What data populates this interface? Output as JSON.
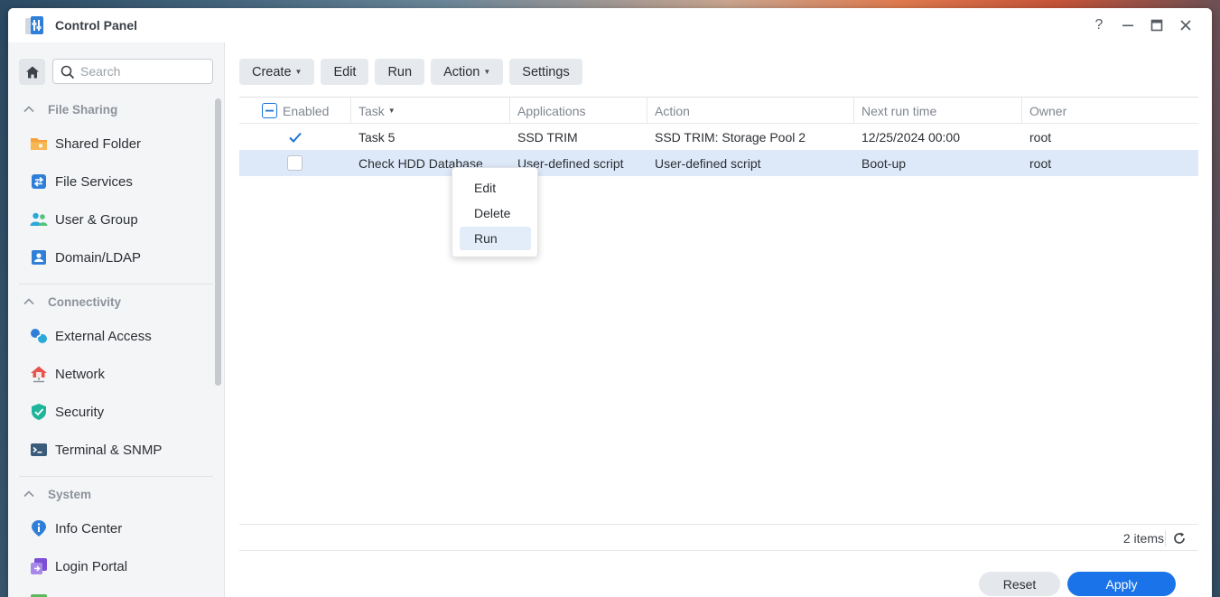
{
  "window": {
    "title": "Control Panel",
    "controls": {
      "help": "?",
      "minimize": "−",
      "maximize": "□",
      "close": "✕"
    }
  },
  "sidebar": {
    "search_placeholder": "Search",
    "sections": [
      {
        "label": "File Sharing",
        "items": [
          {
            "label": "Shared Folder",
            "icon": "shared-folder-icon"
          },
          {
            "label": "File Services",
            "icon": "file-services-icon"
          },
          {
            "label": "User & Group",
            "icon": "user-group-icon"
          },
          {
            "label": "Domain/LDAP",
            "icon": "domain-ldap-icon"
          }
        ]
      },
      {
        "label": "Connectivity",
        "items": [
          {
            "label": "External Access",
            "icon": "external-access-icon"
          },
          {
            "label": "Network",
            "icon": "network-icon"
          },
          {
            "label": "Security",
            "icon": "security-icon"
          },
          {
            "label": "Terminal & SNMP",
            "icon": "terminal-icon"
          }
        ]
      },
      {
        "label": "System",
        "items": [
          {
            "label": "Info Center",
            "icon": "info-center-icon"
          },
          {
            "label": "Login Portal",
            "icon": "login-portal-icon"
          }
        ]
      }
    ]
  },
  "toolbar": {
    "create": "Create",
    "edit": "Edit",
    "run": "Run",
    "action": "Action",
    "settings": "Settings"
  },
  "table": {
    "columns": [
      "Enabled",
      "Task",
      "Applications",
      "Action",
      "Next run time",
      "Owner"
    ],
    "rows": [
      {
        "enabled": true,
        "task": "Task 5",
        "applications": "SSD TRIM",
        "action": "SSD TRIM: Storage Pool 2",
        "next_run": "12/25/2024 00:00",
        "owner": "root",
        "selected": false
      },
      {
        "enabled": false,
        "task": "Check HDD Database",
        "applications": "User-defined script",
        "action": "User-defined script",
        "next_run": "Boot-up",
        "owner": "root",
        "selected": true
      }
    ]
  },
  "context_menu": {
    "items": [
      "Edit",
      "Delete",
      "Run"
    ],
    "highlighted": "Run"
  },
  "status": {
    "items_count": "2 items"
  },
  "footer": {
    "reset": "Reset",
    "apply": "Apply"
  },
  "colors": {
    "accent": "#1a73e8",
    "selected_row": "#dde9f9",
    "sidebar_bg": "#f4f5f7"
  }
}
